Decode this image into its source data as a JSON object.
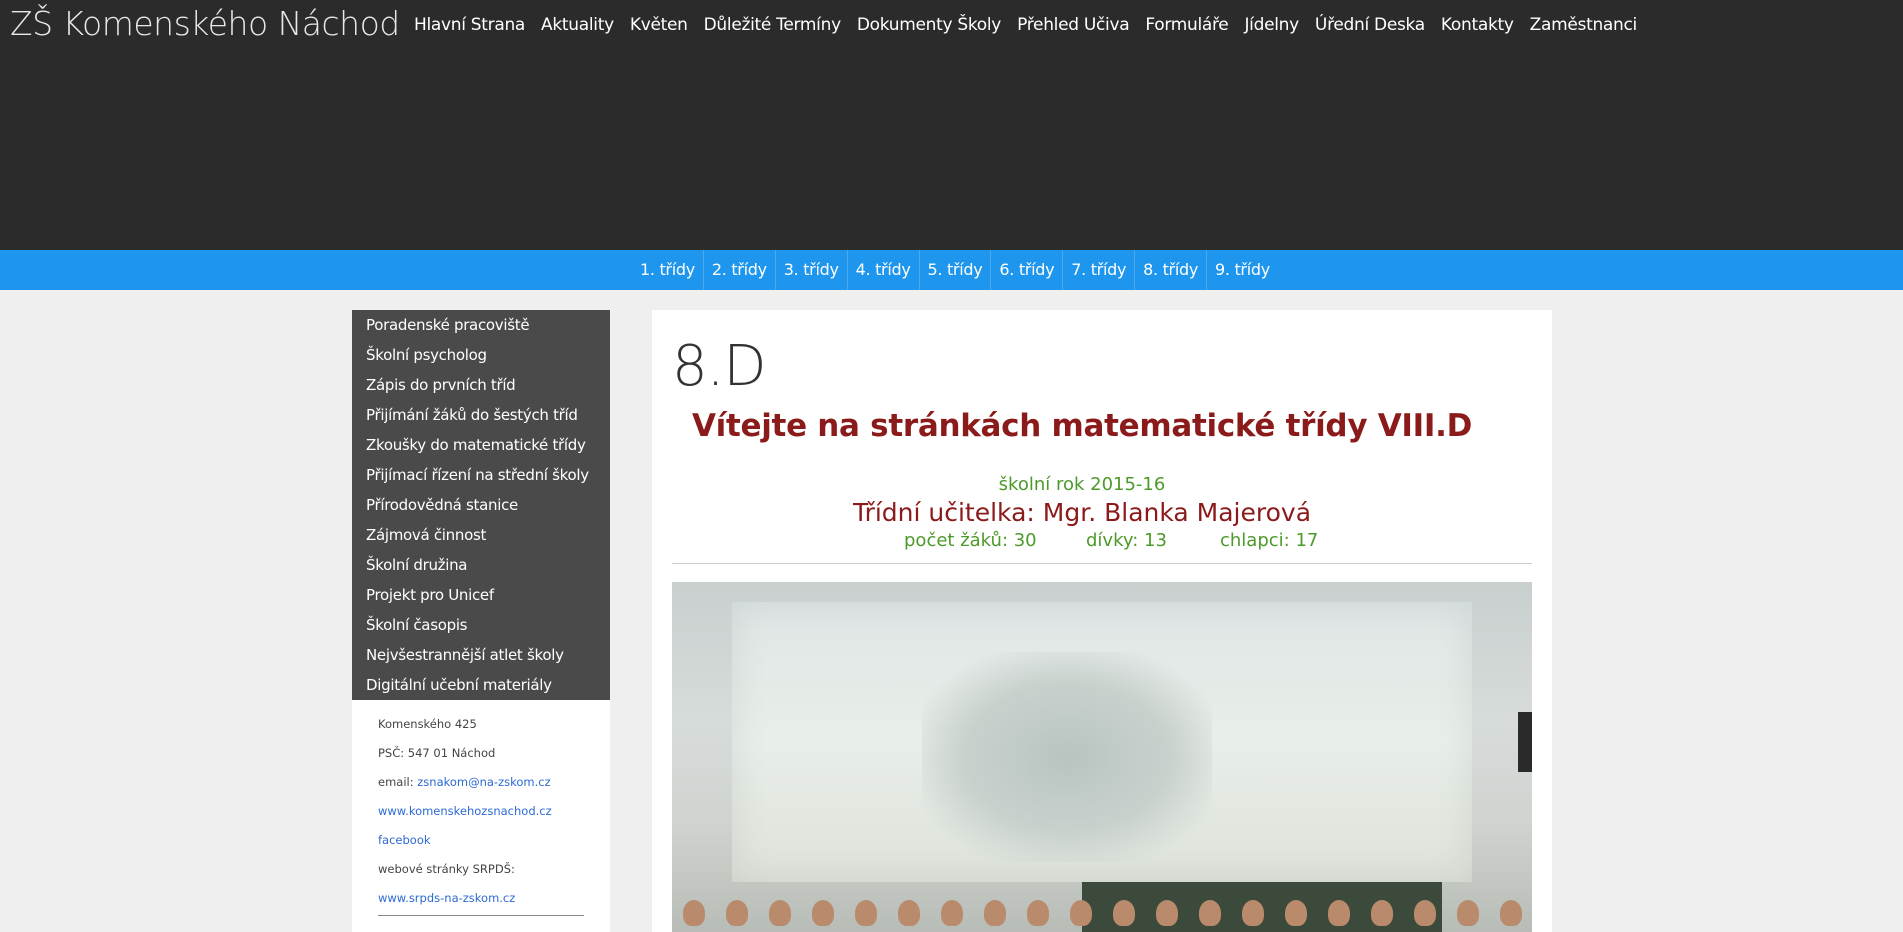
{
  "site": {
    "title": "ZŠ Komenského Náchod"
  },
  "main_nav": [
    {
      "label": "Hlavní Strana"
    },
    {
      "label": "Aktuality"
    },
    {
      "label": "Květen"
    },
    {
      "label": "Důležité Termíny"
    },
    {
      "label": "Dokumenty Školy"
    },
    {
      "label": "Přehled Učiva"
    },
    {
      "label": "Formuláře"
    },
    {
      "label": "Jídelny"
    },
    {
      "label": "Úřední Deska"
    },
    {
      "label": "Kontakty"
    },
    {
      "label": "Zaměstnanci"
    }
  ],
  "class_nav": [
    {
      "label": "1. třídy"
    },
    {
      "label": "2. třídy"
    },
    {
      "label": "3. třídy"
    },
    {
      "label": "4. třídy"
    },
    {
      "label": "5. třídy"
    },
    {
      "label": "6. třídy"
    },
    {
      "label": "7. třídy"
    },
    {
      "label": "8. třídy"
    },
    {
      "label": "9. třídy"
    }
  ],
  "sidebar": {
    "items": [
      {
        "label": "Poradenské pracoviště"
      },
      {
        "label": "Školní psycholog"
      },
      {
        "label": "Zápis do prvních tříd"
      },
      {
        "label": "Přijímání žáků do šestých tříd"
      },
      {
        "label": "Zkoušky do matematické třídy"
      },
      {
        "label": "Přijímací řízení na střední školy"
      },
      {
        "label": "Přírodovědná stanice"
      },
      {
        "label": "Zájmová činnost"
      },
      {
        "label": "Školní družina"
      },
      {
        "label": "Projekt pro Unicef"
      },
      {
        "label": "Školní časopis"
      },
      {
        "label": "Nejvšestrannější atlet školy"
      },
      {
        "label": "Digitální učební materiály"
      }
    ],
    "info": {
      "address": "Komenského 425",
      "postal": "PSČ: 547 01 Náchod",
      "email_label": "email: ",
      "email": "zsnakom@na-zskom.cz",
      "website": "www.komenskehozsnachod.cz",
      "facebook": "facebook",
      "srpds_label": "webové stránky SRPDŠ:",
      "srpds_link": "www.srpds-na-zskom.cz"
    }
  },
  "content": {
    "page_title": "8.D",
    "welcome": "Vítejte na stránkách matematické třídy VIII.D",
    "school_year": "školní rok 2015-16",
    "teacher": "Třídní učitelka: Mgr. Blanka Majerová",
    "stats": {
      "students": "počet žáků: 30",
      "girls": "dívky:  13",
      "boys": "chlapci: 17"
    }
  },
  "colors": {
    "header_bg": "#2b2b2b",
    "classbar_bg": "#1e96ee",
    "sidebar_bg": "#4a4a4a",
    "heading_red": "#8b1a1a",
    "text_green": "#4d9a2a",
    "link_blue": "#2d6ad4"
  }
}
